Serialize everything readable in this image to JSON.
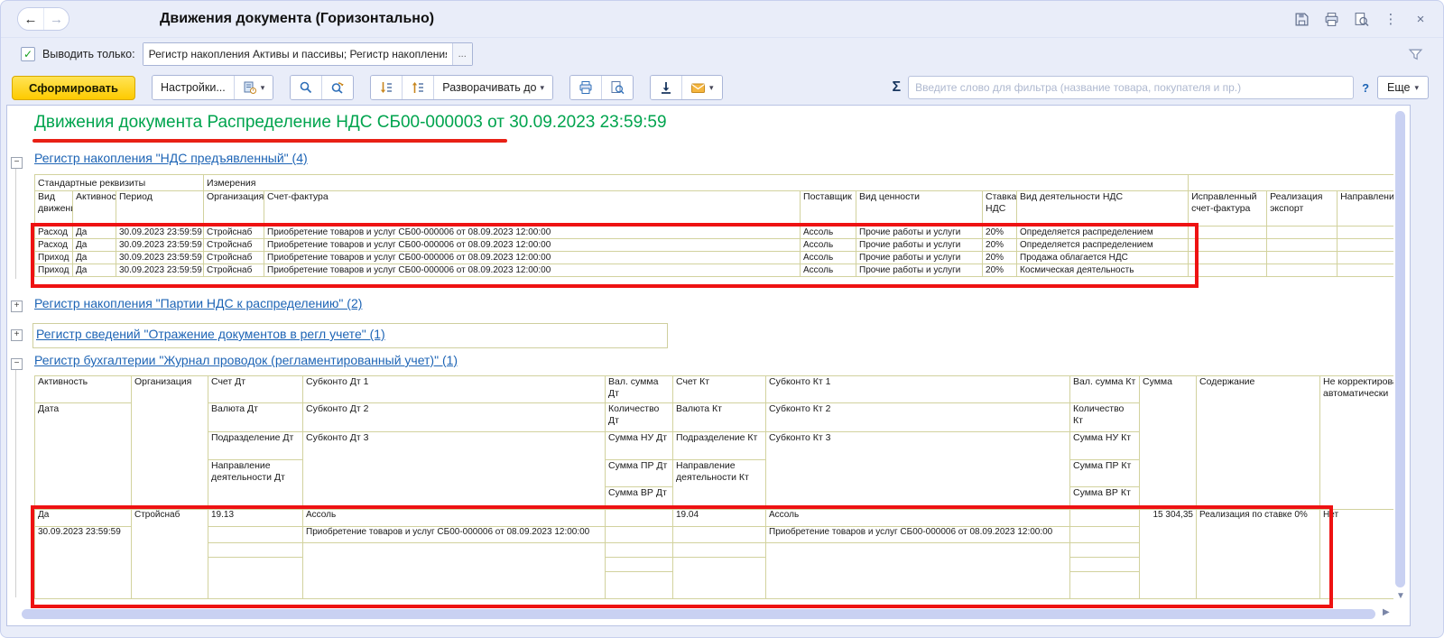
{
  "window": {
    "title": "Движения документа (Горизонтально)"
  },
  "glyphs": {
    "back": "←",
    "forward": "→",
    "kebab": "⋮",
    "close": "×",
    "caret_down": "▾",
    "check": "✓",
    "ellipsis": "...",
    "sigma": "Σ",
    "help": "?",
    "minus": "−",
    "plus": "+",
    "scroll_down": "▼",
    "scroll_right": "▶"
  },
  "filter_bar": {
    "label": "Выводить только:",
    "value": "Регистр накопления Активы и пассивы; Регистр накопления Ам"
  },
  "toolbar": {
    "generate": "Сформировать",
    "settings": "Настройки...",
    "expand_to": "Разворачивать до",
    "filter_placeholder": "Введите слово для фильтра (название товара, покупателя и пр.)",
    "more": "Еще"
  },
  "report": {
    "title": "Движения документа Распределение НДС СБ00-000003 от 30.09.2023 23:59:59"
  },
  "register1": {
    "title": "Регистр накопления \"НДС предъявленный\" (4)",
    "group1": "Стандартные реквизиты",
    "group2": "Измерения",
    "columns": [
      "Вид движения",
      "Активность",
      "Период",
      "Организация",
      "Счет-фактура",
      "Поставщик",
      "Вид ценности",
      "Ставка НДС",
      "Вид деятельности НДС",
      "Исправленный счет-фактура",
      "Реализация экспорт",
      "Направление деятельности"
    ],
    "rows": [
      {
        "movement": "Расход",
        "active": "Да",
        "period": "30.09.2023 23:59:59",
        "org": "Стройснаб",
        "invoice": "Приобретение товаров и услуг СБ00-000006 от 08.09.2023 12:00:00",
        "supplier": "Ассоль",
        "value_kind": "Прочие работы и услуги",
        "vat_rate": "20%",
        "vat_activity": "Определяется распределением"
      },
      {
        "movement": "Расход",
        "active": "Да",
        "period": "30.09.2023 23:59:59",
        "org": "Стройснаб",
        "invoice": "Приобретение товаров и услуг СБ00-000006 от 08.09.2023 12:00:00",
        "supplier": "Ассоль",
        "value_kind": "Прочие работы и услуги",
        "vat_rate": "20%",
        "vat_activity": "Определяется распределением"
      },
      {
        "movement": "Приход",
        "active": "Да",
        "period": "30.09.2023 23:59:59",
        "org": "Стройснаб",
        "invoice": "Приобретение товаров и услуг СБ00-000006 от 08.09.2023 12:00:00",
        "supplier": "Ассоль",
        "value_kind": "Прочие работы и услуги",
        "vat_rate": "20%",
        "vat_activity": "Продажа облагается НДС"
      },
      {
        "movement": "Приход",
        "active": "Да",
        "period": "30.09.2023 23:59:59",
        "org": "Стройснаб",
        "invoice": "Приобретение товаров и услуг СБ00-000006 от 08.09.2023 12:00:00",
        "supplier": "Ассоль",
        "value_kind": "Прочие работы и услуги",
        "vat_rate": "20%",
        "vat_activity": "Космическая деятельность"
      }
    ]
  },
  "register2": {
    "title": "Регистр накопления \"Партии НДС к распределению\" (2)"
  },
  "register3": {
    "title": "Регистр сведений \"Отражение документов в регл учете\" (1)"
  },
  "register4": {
    "title": "Регистр бухгалтерии \"Журнал проводок (регламентированный учет)\" (1)",
    "headers": {
      "h_aktivnost": "Активность",
      "h_data": "Дата",
      "h_org": "Организация",
      "h_schet_dt": "Счет Дт",
      "h_valuta_dt": "Валюта Дт",
      "h_podrazdelenie_dt": "Подразделение Дт",
      "h_napravlenie_dt": "Направление деятельности Дт",
      "h_subkonto_dt1": "Субконто Дт 1",
      "h_subkonto_dt2": "Субконто Дт 2",
      "h_subkonto_dt3": "Субконто Дт 3",
      "h_val_summa_dt": "Вал. сумма Дт",
      "h_kolichestvo_dt": "Количество Дт",
      "h_summa_nu_dt": "Сумма НУ Дт",
      "h_summa_pr_dt": "Сумма ПР Дт",
      "h_summa_vr_dt": "Сумма ВР Дт",
      "h_schet_kt": "Счет Кт",
      "h_valuta_kt": "Валюта Кт",
      "h_podrazdelenie_kt": "Подразделение Кт",
      "h_napravlenie_kt": "Направление деятельности Кт",
      "h_subkonto_kt1": "Субконто Кт 1",
      "h_subkonto_kt2": "Субконто Кт 2",
      "h_subkonto_kt3": "Субконто Кт 3",
      "h_val_summa_kt": "Вал. сумма Кт",
      "h_kolichestvo_kt": "Количество Кт",
      "h_summa_nu_kt": "Сумма НУ Кт",
      "h_summa_pr_kt": "Сумма ПР Кт",
      "h_summa_vr_kt": "Сумма ВР Кт",
      "h_summa": "Сумма",
      "h_soderzhanie": "Содержание",
      "h_ne_korr": "Не корректировать стоимость автоматически"
    },
    "row": {
      "aktivnost": "Да",
      "data": "30.09.2023 23:59:59",
      "org": "Стройснаб",
      "schet_dt": "19.13",
      "subkonto_dt1": "Ассоль",
      "subkonto_dt2": "Приобретение товаров и услуг СБ00-000006 от 08.09.2023 12:00:00",
      "schet_kt": "19.04",
      "subkonto_kt1": "Ассоль",
      "subkonto_kt2": "Приобретение товаров и услуг СБ00-000006 от 08.09.2023 12:00:00",
      "summa": "15 304,35",
      "soderzhanie": "Реализация по ставке 0%",
      "ne_korr": "Нет"
    }
  }
}
